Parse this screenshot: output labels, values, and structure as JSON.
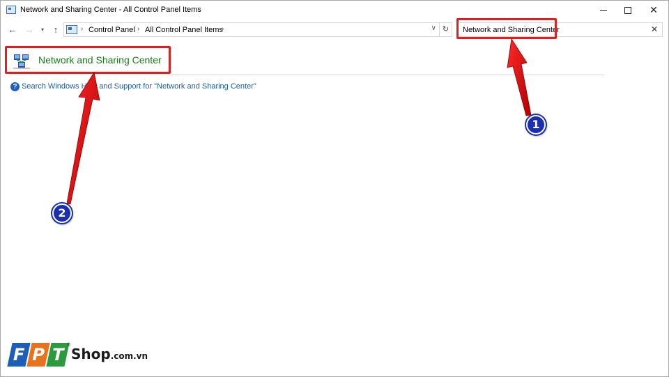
{
  "window": {
    "title": "Network and Sharing Center - All Control Panel Items",
    "controls": {
      "minimize": "minimize",
      "maximize": "maximize",
      "close": "✕"
    }
  },
  "nav": {
    "back": "←",
    "forward": "→",
    "recent": "▾",
    "up": "↑",
    "breadcrumbs": [
      "Control Panel",
      "All Control Panel Items"
    ],
    "crumb_separator": "›",
    "dropdown": "∨",
    "refresh": "↻"
  },
  "search": {
    "value": "Network and Sharing Center",
    "clear": "✕"
  },
  "results": {
    "item_title": "Network and Sharing Center",
    "help_link": "Search Windows Help and Support for \"Network and Sharing Center\"",
    "help_icon": "?"
  },
  "annotations": {
    "badge_1": "1",
    "badge_2": "2",
    "color": "#e02020",
    "badge_color": "#1a2fb0"
  },
  "logo": {
    "letters": [
      "F",
      "P",
      "T"
    ],
    "name": "Shop",
    "suffix": ".com.vn",
    "reg": "®",
    "colors": [
      "#1d5fb8",
      "#e8731e",
      "#2c9a3f"
    ]
  }
}
